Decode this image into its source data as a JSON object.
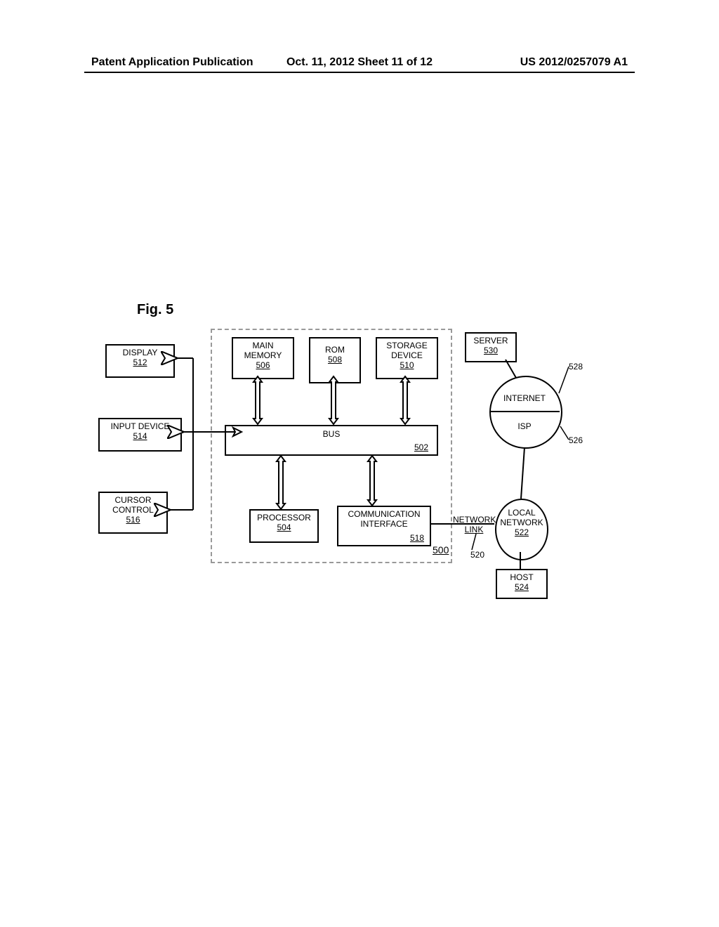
{
  "header": {
    "left": "Patent Application Publication",
    "center": "Oct. 11, 2012  Sheet 11 of 12",
    "right": "US 2012/0257079 A1"
  },
  "figure_title": "Fig. 5",
  "blocks": {
    "display": {
      "label": "DISPLAY",
      "ref": "512"
    },
    "input": {
      "label": "INPUT DEVICE",
      "ref": "514"
    },
    "cursor": {
      "label1": "CURSOR",
      "label2": "CONTROL",
      "ref": "516"
    },
    "main_mem": {
      "label1": "MAIN",
      "label2": "MEMORY",
      "ref": "506"
    },
    "rom": {
      "label": "ROM",
      "ref": "508"
    },
    "storage": {
      "label1": "STORAGE",
      "label2": "DEVICE",
      "ref": "510"
    },
    "processor": {
      "label": "PROCESSOR",
      "ref": "504"
    },
    "comm": {
      "label1": "COMMUNICATION",
      "label2": "INTERFACE",
      "ref": "518"
    },
    "server": {
      "label": "SERVER",
      "ref": "530"
    },
    "host": {
      "label": "HOST",
      "ref": "524"
    }
  },
  "bus": {
    "label": "BUS",
    "ref": "502"
  },
  "computer_ref": "500",
  "net": {
    "internet": "INTERNET",
    "isp": "ISP",
    "local1": "LOCAL",
    "local2": "NETWORK",
    "local_ref": "522",
    "net_link1": "NETWORK",
    "net_link2": "LINK",
    "net_link_ref": "520",
    "isp_callout": "526",
    "internet_callout": "528"
  }
}
